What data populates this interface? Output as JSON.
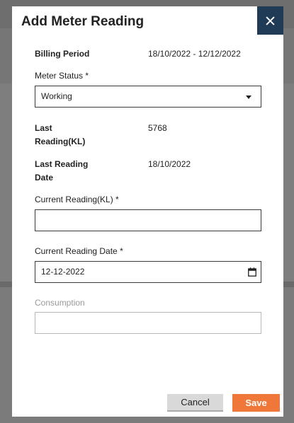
{
  "modal": {
    "title": "Add Meter Reading",
    "close_icon": "close-icon"
  },
  "billing_period": {
    "label": "Billing Period",
    "value": "18/10/2022 - 12/12/2022"
  },
  "meter_status": {
    "label": "Meter Status *",
    "value": "Working",
    "icon": "chevron-down-icon"
  },
  "last_reading": {
    "label_line1": "Last",
    "label_line2": "Reading(KL)",
    "value": "5768"
  },
  "last_reading_date": {
    "label_line1": "Last Reading",
    "label_line2": "Date",
    "value": "18/10/2022"
  },
  "current_reading": {
    "label": "Current Reading(KL) *",
    "value": ""
  },
  "current_reading_date": {
    "label": "Current Reading Date *",
    "value": "12-12-2022",
    "icon": "calendar-icon"
  },
  "consumption": {
    "label": "Consumption",
    "value": ""
  },
  "footer": {
    "cancel_label": "Cancel",
    "save_label": "Save"
  },
  "colors": {
    "close_bg": "#1f3b56",
    "save_bg": "#f0773a",
    "cancel_bg": "#d9d9d9"
  }
}
